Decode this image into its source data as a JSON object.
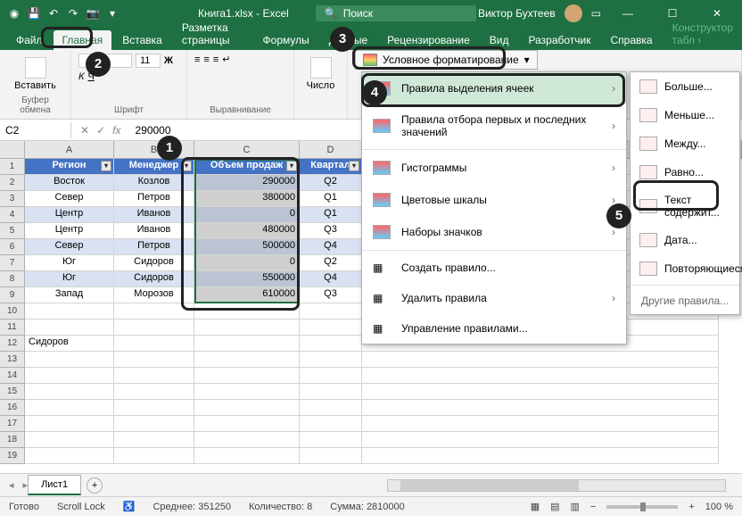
{
  "titlebar": {
    "filename": "Книга1.xlsx - Excel",
    "search_placeholder": "Поиск",
    "username": "Виктор Бухтеев"
  },
  "tabs": {
    "items": [
      "Файл",
      "Главная",
      "Вставка",
      "Разметка страницы",
      "Формулы",
      "Данные",
      "Рецензирование",
      "Вид",
      "Разработчик",
      "Справка"
    ],
    "active": 1,
    "contextual": "Конструктор табл ›"
  },
  "ribbon": {
    "clipboard": {
      "paste": "Вставить",
      "group": "Буфер обмена"
    },
    "font": {
      "size": "11",
      "group": "Шрифт"
    },
    "align": {
      "group": "Выравнивание"
    },
    "number": {
      "label": "Число"
    },
    "cf_button": "Условное форматирование"
  },
  "formula": {
    "cell": "C2",
    "value": "290000"
  },
  "columns": [
    "A",
    "B",
    "C",
    "D"
  ],
  "rowcount": 19,
  "headers": [
    "Регион",
    "Менеджер",
    "Объем продаж",
    "Квартал"
  ],
  "table": [
    {
      "r": "Восток",
      "m": "Козлов",
      "v": "290000",
      "q": "Q2"
    },
    {
      "r": "Север",
      "m": "Петров",
      "v": "380000",
      "q": "Q1"
    },
    {
      "r": "Центр",
      "m": "Иванов",
      "v": "0",
      "q": "Q1"
    },
    {
      "r": "Центр",
      "m": "Иванов",
      "v": "480000",
      "q": "Q3"
    },
    {
      "r": "Север",
      "m": "Петров",
      "v": "500000",
      "q": "Q4"
    },
    {
      "r": "Юг",
      "m": "Сидоров",
      "v": "0",
      "q": "Q2"
    },
    {
      "r": "Юг",
      "m": "Сидоров",
      "v": "550000",
      "q": "Q4"
    },
    {
      "r": "Запад",
      "m": "Морозов",
      "v": "610000",
      "q": "Q3"
    }
  ],
  "extra_cell": "Сидоров",
  "sheet": "Лист1",
  "status": {
    "ready": "Готово",
    "scroll": "Scroll Lock",
    "avg": "Среднее: 351250",
    "count": "Количество: 8",
    "sum": "Сумма: 2810000",
    "zoom": "100 %"
  },
  "menu1": {
    "items": [
      "Правила выделения ячеек",
      "Правила отбора первых и последних значений",
      "Гистограммы",
      "Цветовые шкалы",
      "Наборы значков"
    ],
    "create": "Создать правило...",
    "clear": "Удалить правила",
    "manage": "Управление правилами..."
  },
  "menu2": {
    "items": [
      "Больше...",
      "Меньше...",
      "Между...",
      "Равно...",
      "Текст содержит...",
      "Дата...",
      "Повторяющиеся..."
    ],
    "other": "Другие правила..."
  }
}
